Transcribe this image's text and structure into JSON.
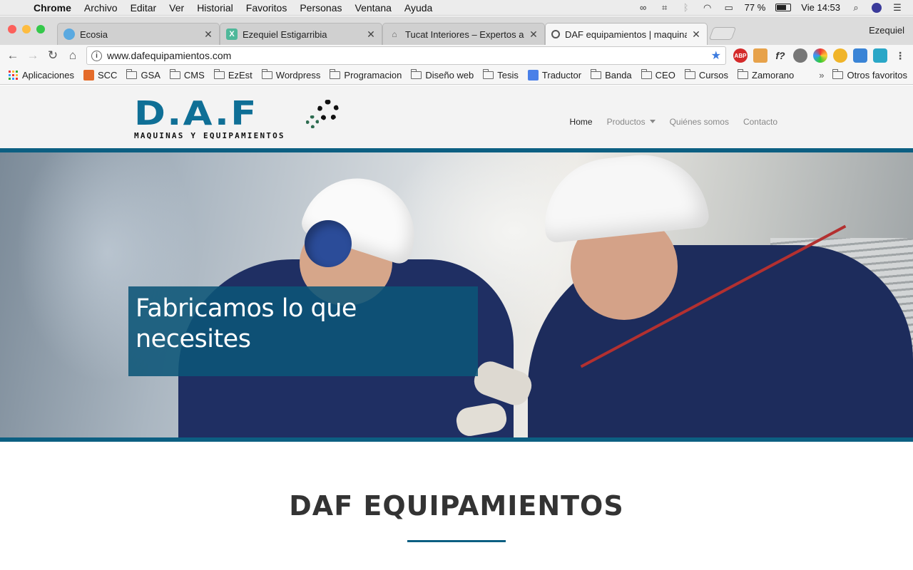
{
  "menubar": {
    "app": "Chrome",
    "items": [
      "Archivo",
      "Editar",
      "Ver",
      "Historial",
      "Favoritos",
      "Personas",
      "Ventana",
      "Ayuda"
    ],
    "battery": "77 %",
    "battery_level": 0.77,
    "clock": "Vie 14:53"
  },
  "tabs": [
    {
      "label": "Ecosia",
      "favicon_color": "#5aa9e0"
    },
    {
      "label": "Ezequiel Estigarribia",
      "favicon_color": "#4fb89a"
    },
    {
      "label": "Tucat Interiores – Expertos a m",
      "favicon_color": "#888888"
    },
    {
      "label": "DAF equipamientos | maquinas",
      "favicon_color": "#555555"
    }
  ],
  "profile": "Ezequiel",
  "omnibox": {
    "url": "www.dafequipamientos.com"
  },
  "bookmarks": {
    "items": [
      "Aplicaciones",
      "SCC",
      "GSA",
      "CMS",
      "EzEst",
      "Wordpress",
      "Programacion",
      "Diseño web",
      "Tesis",
      "Traductor",
      "Banda",
      "CEO",
      "Cursos",
      "Zamorano"
    ],
    "overflow": "»",
    "other": "Otros favoritos"
  },
  "site": {
    "logo": {
      "letters": "D.A.F",
      "tagline": "MAQUINAS Y EQUIPAMIENTOS"
    },
    "nav": [
      "Home",
      "Productos",
      "Quiénes somos",
      "Contacto"
    ],
    "hero": {
      "line1": "Fabricamos lo que",
      "line2": "necesites"
    },
    "section_title": "DAF EQUIPAMIENTOS",
    "brand_color": "#0c5f82"
  }
}
